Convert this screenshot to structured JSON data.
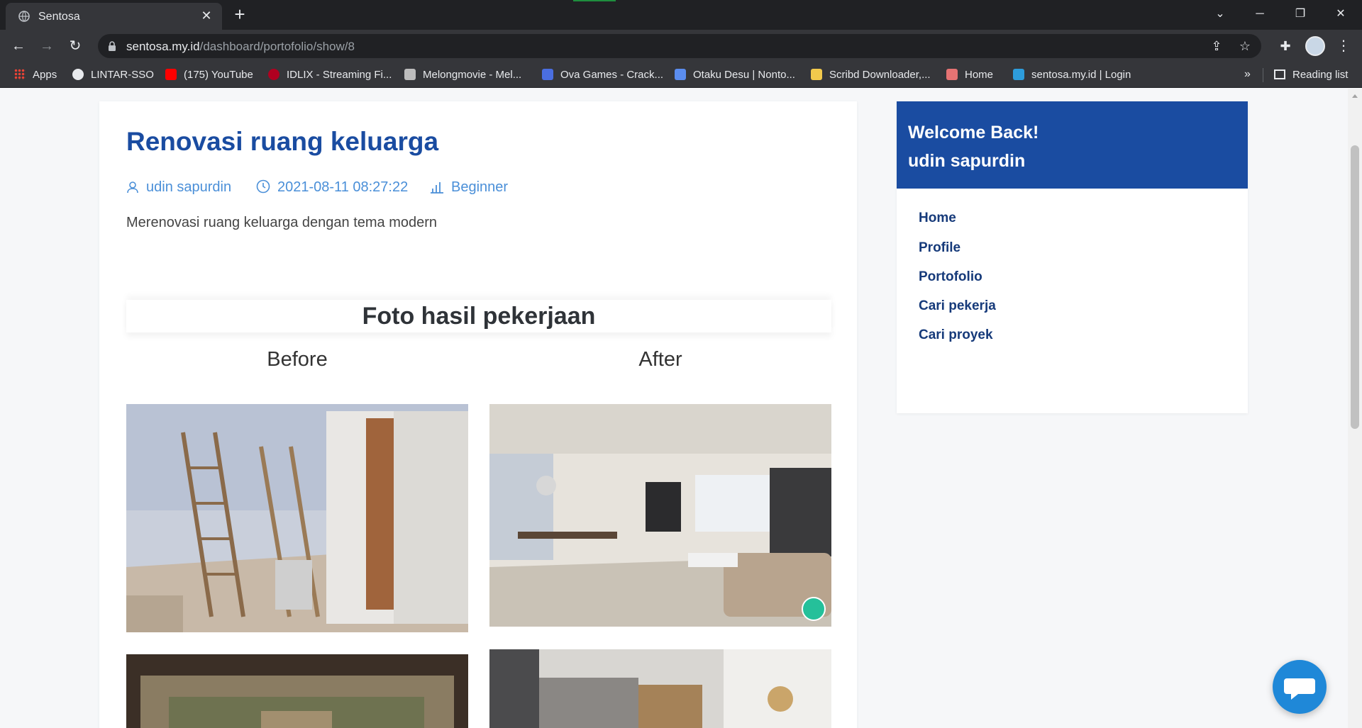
{
  "browser": {
    "tab_title": "Sentosa",
    "url_host": "sentosa.my.id",
    "url_path": "/dashboard/portofolio/show/8",
    "bookmarks": [
      {
        "label": "Apps",
        "color": "#ea4335"
      },
      {
        "label": "LINTAR-SSO",
        "color": "#e8eaed"
      },
      {
        "label": "(175) YouTube",
        "color": "#ff0000"
      },
      {
        "label": "IDLIX - Streaming Fi...",
        "color": "#b00020"
      },
      {
        "label": "Melongmovie - Mel...",
        "color": "#bdbdbd"
      },
      {
        "label": "Ova Games - Crack...",
        "color": "#4a6ee0"
      },
      {
        "label": "Otaku Desu | Nonto...",
        "color": "#5b8def"
      },
      {
        "label": "Scribd Downloader,...",
        "color": "#f2c94c"
      },
      {
        "label": "Home",
        "color": "#e57373"
      },
      {
        "label": "sentosa.my.id | Login",
        "color": "#2d9cdb"
      }
    ],
    "reading_list": "Reading list",
    "more": "»"
  },
  "post": {
    "title": "Renovasi ruang keluarga",
    "author": "udin sapurdin",
    "datetime": "2021-08-11 08:27:22",
    "level": "Beginner",
    "description": "Merenovasi ruang keluarga dengan tema modern",
    "section_title": "Foto hasil pekerjaan",
    "before_label": "Before",
    "after_label": "After"
  },
  "sidebar": {
    "welcome": "Welcome Back!",
    "user": "udin sapurdin",
    "links": [
      "Home",
      "Profile",
      "Portofolio",
      "Cari pekerja",
      "Cari proyek"
    ]
  },
  "colors": {
    "primary": "#1a4ca1",
    "meta": "#4a8fd8",
    "chat": "#1f88d8"
  }
}
